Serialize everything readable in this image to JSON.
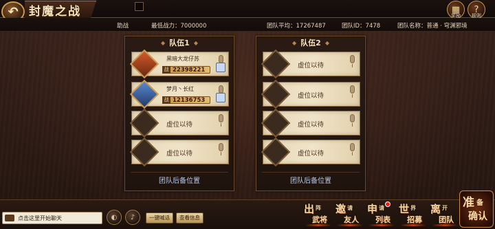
{
  "header": {
    "title": "封魔之战",
    "reward_label": "奖励",
    "rules_label": "规则"
  },
  "info": {
    "assist_label": "助战",
    "min_power": "最低战力：7000000",
    "team_avg": "团队平均：17267487",
    "team_id": "团队ID：7478",
    "team_name": "团队名称：普通 · 穹渊邪境"
  },
  "teams": [
    {
      "title": "队伍1",
      "slots": [
        {
          "filled": true,
          "name": "黑暗大龙仔苏",
          "power": "22398221",
          "avatar": "red"
        },
        {
          "filled": true,
          "name": "梦月丶长红",
          "power": "12136753",
          "avatar": "blue"
        },
        {
          "filled": false,
          "label": "虚位以待"
        },
        {
          "filled": false,
          "label": "虚位以待"
        }
      ],
      "footer": "团队后备位置"
    },
    {
      "title": "队伍2",
      "slots": [
        {
          "filled": false,
          "label": "虚位以待"
        },
        {
          "filled": false,
          "label": "虚位以待"
        },
        {
          "filled": false,
          "label": "虚位以待"
        },
        {
          "filled": false,
          "label": "虚位以待"
        }
      ],
      "footer": "团队后备位置"
    }
  ],
  "bottom": {
    "chat_placeholder": "点击这里开始聊天",
    "chat_btn_1": "一键喊话",
    "chat_btn_2": "查看信息",
    "actions": [
      {
        "big": "出",
        "top": "阵",
        "bottom": "武将"
      },
      {
        "big": "邀",
        "top": "请",
        "bottom": "友人"
      },
      {
        "big": "申",
        "top": "请",
        "bottom": "列表"
      },
      {
        "big": "世",
        "top": "界",
        "bottom": "招募"
      },
      {
        "big": "离",
        "top": "开",
        "bottom": "团队"
      }
    ],
    "confirm": {
      "big": "准",
      "top": "备",
      "bottom": "确认"
    }
  }
}
